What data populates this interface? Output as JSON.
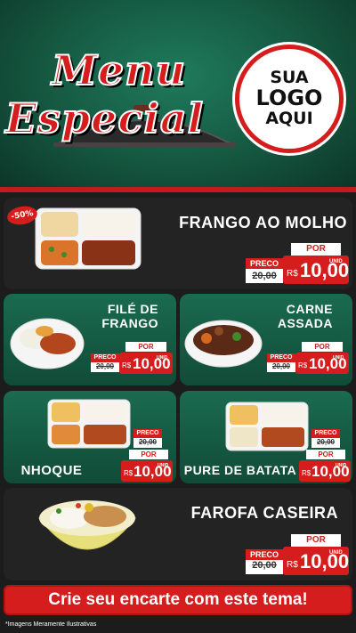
{
  "header": {
    "title_line1": "Menu",
    "title_line2": "Especial",
    "logo_line1": "SUA",
    "logo_line2": "LOGO",
    "logo_line3": "AQUI"
  },
  "items": [
    {
      "name_line1": "FRANGO AO MOLHO",
      "name_line2": "",
      "discount_badge": "-50%",
      "preco_label": "PRECO",
      "old_price": "20,00",
      "por_label": "POR",
      "currency": "R$",
      "price": "10,00",
      "unit": "UNID"
    },
    {
      "name_line1": "FILÉ DE",
      "name_line2": "FRANGO",
      "preco_label": "PRECO",
      "old_price": "20,00",
      "por_label": "POR",
      "currency": "R$",
      "price": "10,00",
      "unit": "UNID"
    },
    {
      "name_line1": "CARNE",
      "name_line2": "ASSADA",
      "preco_label": "PRECO",
      "old_price": "20,00",
      "por_label": "POR",
      "currency": "R$",
      "price": "10,00",
      "unit": "UNID"
    },
    {
      "name_line1": "NHOQUE",
      "name_line2": "",
      "preco_label": "PRECO",
      "old_price": "20,00",
      "por_label": "POR",
      "currency": "R$",
      "price": "10,00",
      "unit": "UNID"
    },
    {
      "name_line1": "PURE DE BATATA",
      "name_line2": "",
      "preco_label": "PRECO",
      "old_price": "20,00",
      "por_label": "POR",
      "currency": "R$",
      "price": "10,00",
      "unit": "UNID"
    },
    {
      "name_line1": "FAROFA CASEIRA",
      "name_line2": "",
      "preco_label": "PRECO",
      "old_price": "20,00",
      "por_label": "POR",
      "currency": "R$",
      "price": "10,00",
      "unit": "UNID"
    }
  ],
  "cta": {
    "label": "Crie seu encarte com este tema!"
  },
  "footer": {
    "note": "*Imagens Meramente Ilustrativas"
  },
  "colors": {
    "brand_red": "#d51d1d",
    "green": "#155740",
    "dark": "#232323"
  }
}
